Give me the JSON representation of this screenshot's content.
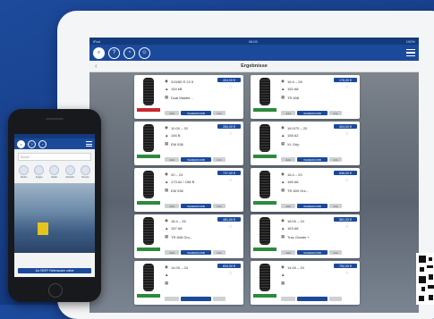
{
  "tablet": {
    "status": {
      "carrier": "iPad",
      "time": "08:00",
      "battery": "100%"
    },
    "appbar": {
      "icons": [
        "search-icon",
        "help-icon",
        "gauge-icon",
        "contact-icon"
      ],
      "menu_icon": "hamburger-menu-icon"
    },
    "title": "Ergebnisse",
    "back_glyph": "‹",
    "cards": [
      {
        "size": "315/80 R 22.5",
        "load": "154 kB",
        "name": "Dual Master...",
        "price": "404,00 €",
        "btn1": "Add",
        "btn2": "WARENKORB",
        "btn3": "Info",
        "brand": true
      },
      {
        "size": "16.9 – 28",
        "load": "152 A8",
        "name": "TR 608",
        "price": "176,00 €",
        "btn1": "Add",
        "btn2": "WARENKORB",
        "btn3": "Info",
        "brand": false
      },
      {
        "size": "10.00 – 20",
        "load": "146 B",
        "name": "EM 936",
        "price": "284,00 €",
        "btn1": "Add",
        "btn2": "WARENKORB",
        "btn3": "Info",
        "brand": false
      },
      {
        "size": "16.0/70 – 20",
        "load": "158 A2",
        "name": "XL Grip",
        "price": "404,00 €",
        "btn1": "Add",
        "btn2": "WARENKORB",
        "btn3": "Info",
        "brand": false
      },
      {
        "size": "20 – 24",
        "load": "173 A2 / 158 B",
        "name": "EM 936",
        "price": "737,00 €",
        "btn1": "Add",
        "btn2": "WARENKORB",
        "btn3": "Info",
        "brand": false
      },
      {
        "size": "16.4 – 20",
        "load": "166 A8",
        "name": "TR 609 Grs...",
        "price": "636,00 €",
        "btn1": "Add",
        "btn2": "WARENKORB",
        "btn3": "Info",
        "brand": false
      },
      {
        "size": "18.4 – 26",
        "load": "157 A8",
        "name": "TR 608 Gru...",
        "price": "481,00 €",
        "btn1": "Add",
        "btn2": "WARENKORB",
        "btn3": "Info",
        "brand": false
      },
      {
        "size": "18.00 – 24",
        "load": "163 A8",
        "name": "Trac Grader +",
        "price": "561,00 €",
        "btn1": "Add",
        "btn2": "WARENKORB",
        "btn3": "Info",
        "brand": false
      },
      {
        "size": "14.00 – 24",
        "load": "",
        "name": "",
        "price": "634,00 €",
        "btn1": "",
        "btn2": "",
        "btn3": "",
        "brand": false
      },
      {
        "size": "14.00 – 24",
        "load": "",
        "name": "",
        "price": "752,00 €",
        "btn1": "",
        "btn2": "",
        "btn3": "",
        "brand": false
      }
    ]
  },
  "phone": {
    "search_placeholder": "Suche",
    "tiles": [
      "Reifen",
      "Felgen",
      "Räder",
      "Zubehör",
      "Service"
    ],
    "cta": "Zur REIFF Reifensuche online"
  },
  "colors": {
    "brand_blue": "#1b4a9a",
    "background": "#173f89"
  }
}
